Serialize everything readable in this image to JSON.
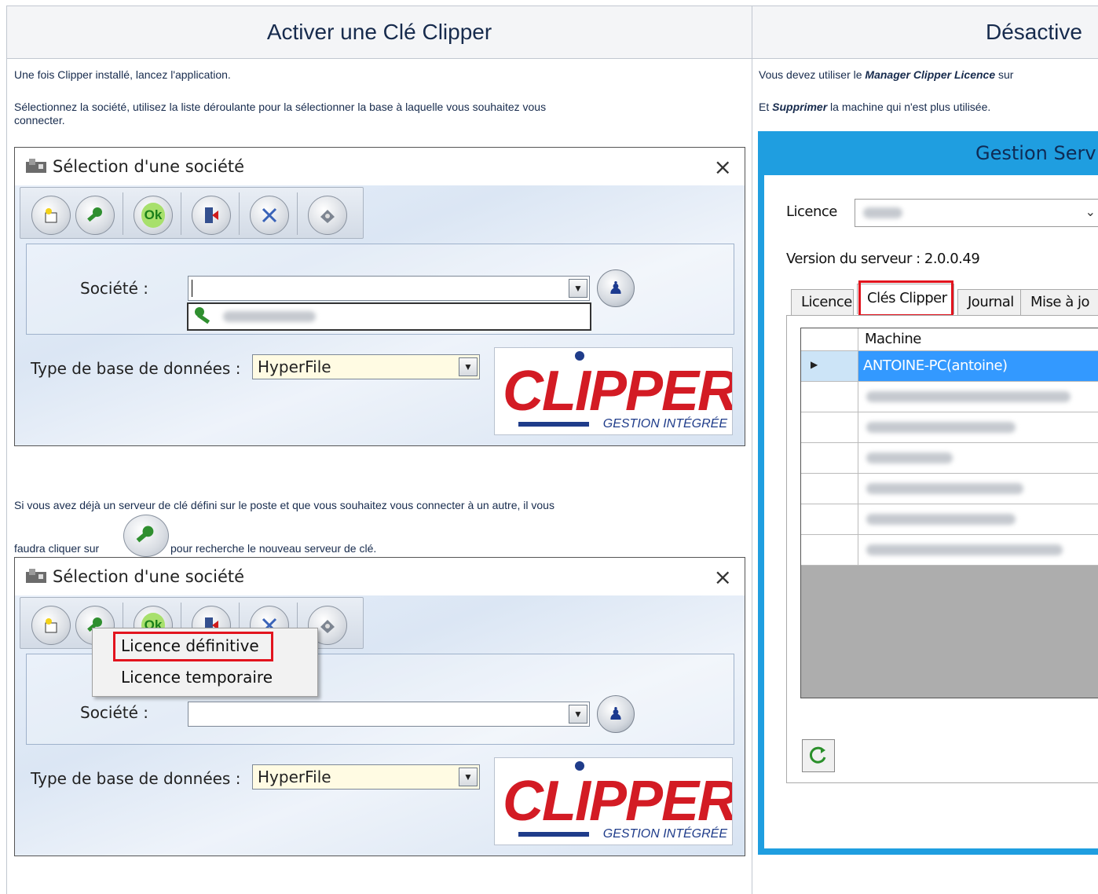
{
  "left_column": {
    "heading": "Activer une Clé Clipper",
    "p1": "Une fois Clipper installé, lancez l'application.",
    "p2_line1": "Sélectionnez la société, utilisez la liste déroulante pour la sélectionner la base à laquelle vous souhaitez vous",
    "p2_line2": "connecter.",
    "p3_line1": "Si vous avez déjà un serveur de clé défini sur le poste et que vous souhaitez vous connecter à un autre, il vous",
    "p3_line2a": "faudra cliquer sur",
    "p3_line2b": "pour recherche le nouveau serveur de clé."
  },
  "dialog": {
    "title": "Sélection d'une société",
    "close": "×",
    "ok_label": "Ok",
    "societe_label": "Société :",
    "db_type_label": "Type de base de données :",
    "db_type_value": "HyperFile",
    "logo_text": "CLIPPER",
    "logo_sub": "GESTION INTÉGRÉE",
    "toolbar_icons": [
      "new-folder-icon",
      "key-search-icon",
      "ok-icon",
      "exit-door-icon",
      "tools-icon",
      "settings-disk-icon"
    ]
  },
  "context_menu": {
    "items": [
      "Licence définitive",
      "Licence temporaire"
    ]
  },
  "right_column": {
    "heading": "Désactive",
    "p1_a": "Vous devez utiliser le ",
    "p1_b": "Manager Clipper Licence",
    "p1_c": " sur",
    "p2_a": "Et ",
    "p2_b": "Supprimer",
    "p2_c": " la machine qui n'est plus utilisée."
  },
  "manager": {
    "title": "Gestion Serv",
    "licence_label": "Licence",
    "version_text": "Version du serveur : 2.0.0.49",
    "tabs": [
      "Licence",
      "Clés Clipper",
      "Journal",
      "Mise à jo"
    ],
    "column_header": "Machine",
    "selected_row": "ANTOINE-PC(antoine)",
    "refresh_icon": "refresh-icon",
    "colors": {
      "frame": "#1f9ee0",
      "selection": "#3399ff",
      "highlight": "#e2141e"
    }
  }
}
